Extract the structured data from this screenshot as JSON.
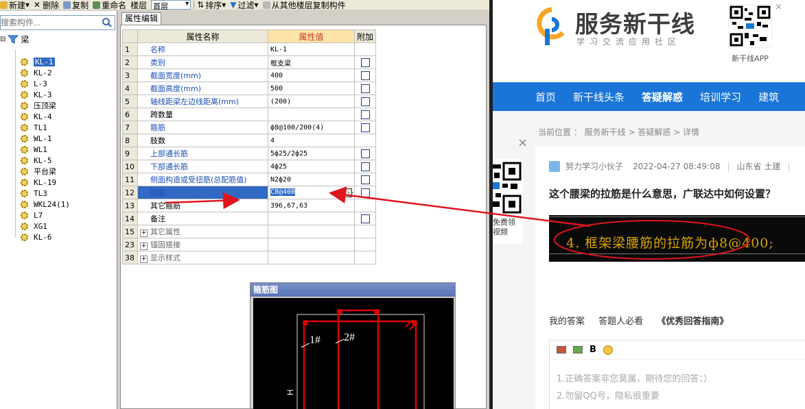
{
  "toolbar": {
    "items": [
      "新建",
      "删除",
      "复制",
      "重命名",
      "楼层"
    ],
    "floor_value": "首层",
    "sort_label": "排序",
    "filter_label": "过滤",
    "copy_from_label": "从其他楼层复制构件"
  },
  "left_panel": {
    "search_placeholder": "搜索构件...",
    "root_label": "梁",
    "items": [
      "KL-1",
      "KL-2",
      "L-3",
      "KL-3",
      "压顶梁",
      "KL-4",
      "TL1",
      "WL-1",
      "WL1",
      "KL-5",
      "平台梁",
      "KL-19",
      "TL3",
      "WKL24(1)",
      "L7",
      "XG1",
      "KL-6"
    ],
    "selected_index": 0
  },
  "property_editor": {
    "tab_label": "属性编辑",
    "headers": [
      "属性名称",
      "属性值",
      "附加"
    ],
    "rows": [
      {
        "num": "1",
        "name": "名称",
        "value": "KL-1",
        "checkbox": false
      },
      {
        "num": "2",
        "name": "类别",
        "value": "框支梁",
        "checkbox": true
      },
      {
        "num": "3",
        "name": "截面宽度(mm)",
        "value": "400",
        "checkbox": true
      },
      {
        "num": "4",
        "name": "截面高度(mm)",
        "value": "500",
        "checkbox": true
      },
      {
        "num": "5",
        "name": "轴线距梁左边线距离(mm)",
        "value": "(200)",
        "checkbox": true
      },
      {
        "num": "6",
        "name": "跨数量",
        "value": "",
        "checkbox": true
      },
      {
        "num": "7",
        "name": "箍筋",
        "value": "ф8@100/200(4)",
        "checkbox": true
      },
      {
        "num": "8",
        "name": "肢数",
        "value": "4",
        "checkbox": false
      },
      {
        "num": "9",
        "name": "上部通长筋",
        "value": "5ф25/2ф25",
        "checkbox": true
      },
      {
        "num": "10",
        "name": "下部通长筋",
        "value": "4ф25",
        "checkbox": true
      },
      {
        "num": "11",
        "name": "侧面构造或受扭筋(总配筋值)",
        "value": "N2ф20",
        "checkbox": true
      },
      {
        "num": "12",
        "name": "拉筋",
        "value": "C8@400",
        "checkbox": true
      },
      {
        "num": "13",
        "name": "其它箍筋",
        "value": "396,67,63",
        "checkbox": false
      },
      {
        "num": "14",
        "name": "备注",
        "value": "",
        "checkbox": true
      },
      {
        "num": "15",
        "name": "其它属性",
        "value": "",
        "checkbox": false
      },
      {
        "num": "23",
        "name": "锚固搭接",
        "value": "",
        "checkbox": false
      },
      {
        "num": "38",
        "name": "显示样式",
        "value": "",
        "checkbox": false
      }
    ],
    "selected_row": 11,
    "ellipsis_label": "..."
  },
  "stirrup_window": {
    "title": "箍筋图",
    "labels": [
      "1#",
      "2#",
      "H"
    ]
  },
  "web": {
    "logo_main": "服务新干线",
    "logo_sub": "学习交流应用社区",
    "app_label": "新干线APP",
    "close_label": "×",
    "nav": [
      "首页",
      "新干线头条",
      "答疑解惑",
      "培训学习",
      "建筑"
    ],
    "nav_active": 2,
    "breadcrumb": "当前位置 ： 服务新干线 > 答疑解惑 > 详情",
    "ad_close": "×",
    "ad_text": "免费领\n视频",
    "author": "努力学习小伙子",
    "date": "2022-04-27 08:49:08",
    "location": "山东省 土建",
    "divider": "|",
    "question_title": "这个腰梁的拉筋是什么意思，广联达中如何设置？",
    "image_text": "4. 框架梁腰筋的拉筋为ф8@400;",
    "answer_tabs": [
      "我的答案",
      "答题人必看",
      "《优秀回答指南》"
    ],
    "editor_bold": "B",
    "editor_placeholder_1": "1.正确答案非您莫属，期待您的回答：）",
    "editor_placeholder_2": "2.勿留QQ号，隐私很重要"
  },
  "colors": {
    "nav_blue": "#1a75d8",
    "selection_blue": "#316ac5",
    "annotation_red": "#e0141e",
    "header_orange": "#fce4a8"
  }
}
